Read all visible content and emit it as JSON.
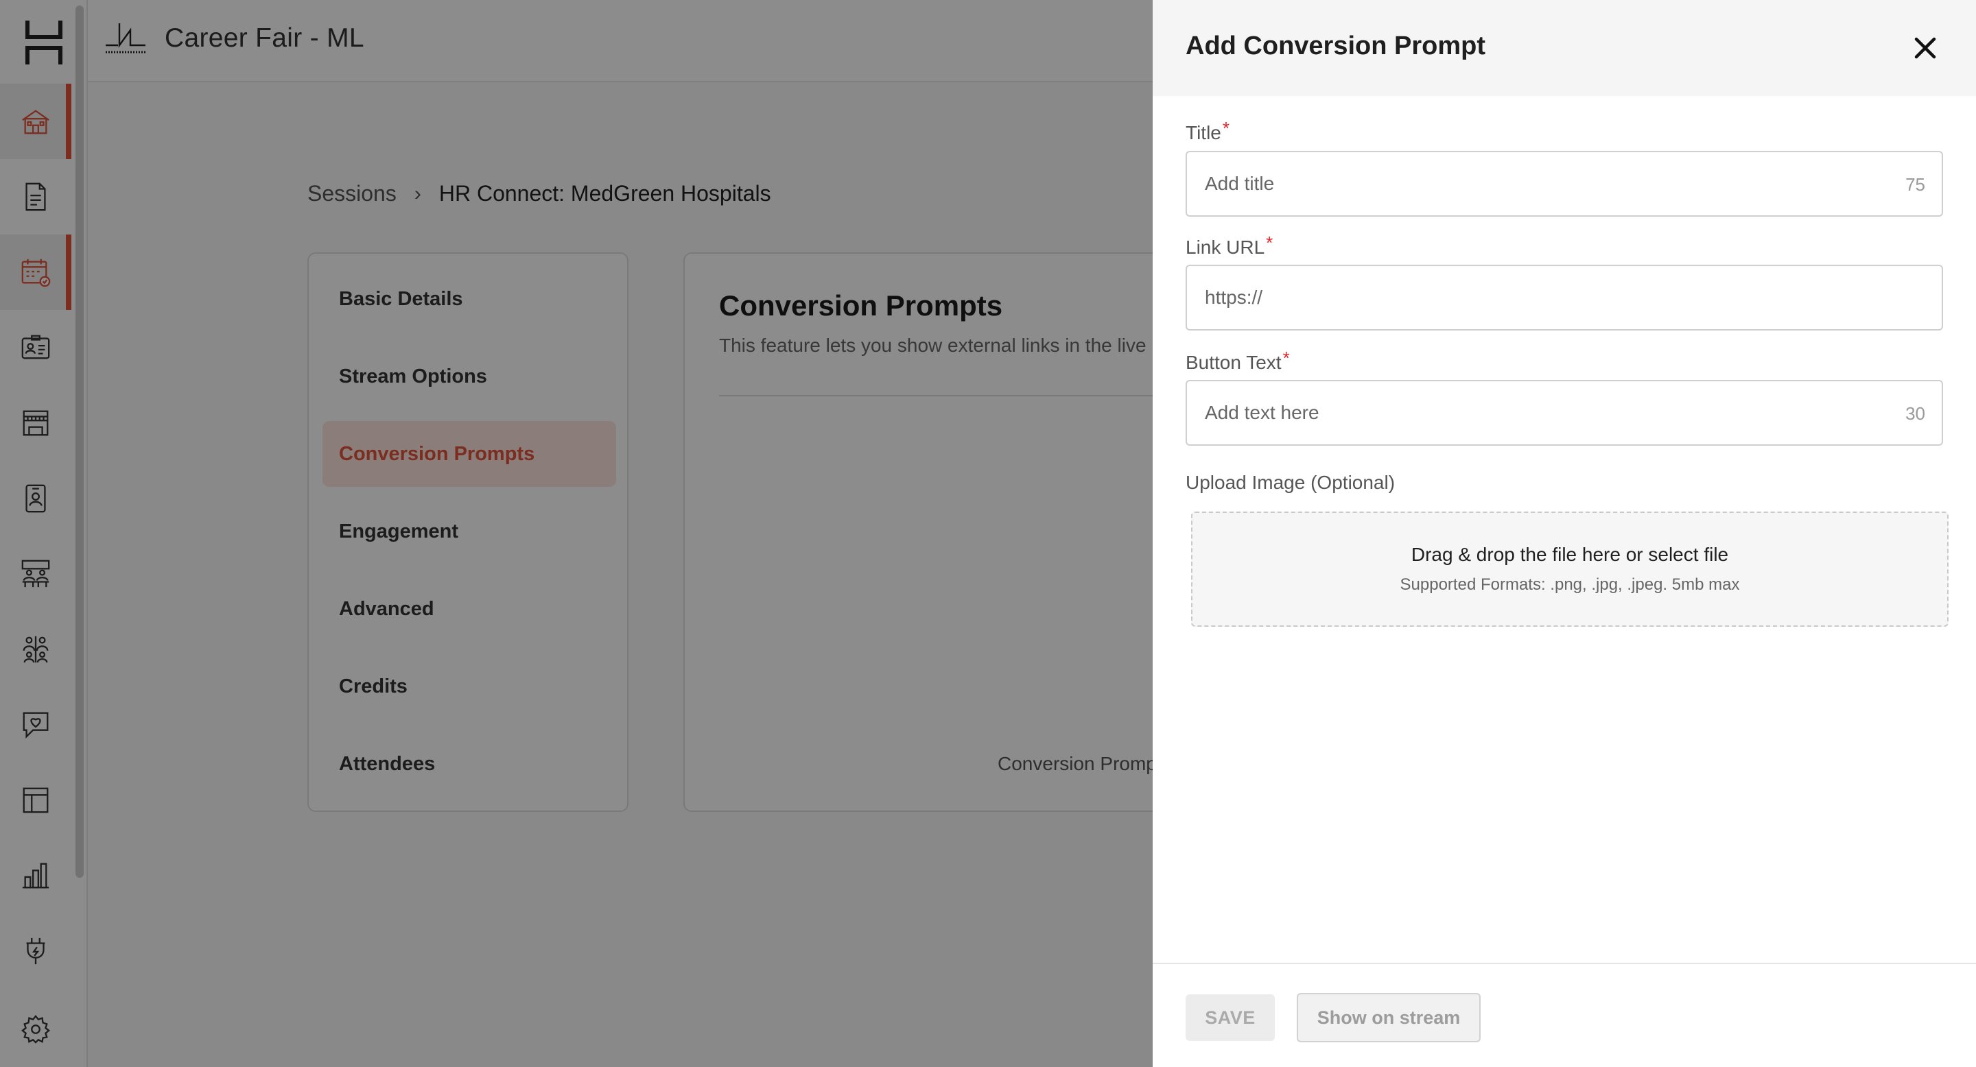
{
  "app": {
    "event_title": "Career Fair - ML",
    "rail_icons": [
      "app-logo-icon",
      "home-icon",
      "document-icon",
      "calendar-icon",
      "id-card-icon",
      "booth-icon",
      "badge-icon",
      "lounge-icon",
      "networking-icon",
      "chat-heart-icon",
      "layout-icon",
      "analytics-icon",
      "integrations-icon",
      "settings-icon"
    ],
    "active_rail_items": [
      "home-icon",
      "calendar-icon"
    ]
  },
  "breadcrumb": {
    "root": "Sessions",
    "separator": "›",
    "current": "HR Connect: MedGreen Hospitals"
  },
  "side_menu": {
    "items": [
      {
        "label": "Basic Details"
      },
      {
        "label": "Stream Options"
      },
      {
        "label": "Conversion Prompts",
        "active": true
      },
      {
        "label": "Engagement"
      },
      {
        "label": "Advanced"
      },
      {
        "label": "Credits"
      },
      {
        "label": "Attendees"
      }
    ]
  },
  "content": {
    "title": "Conversion Prompts",
    "description": "This feature lets you show external links in the live",
    "empty_label": "Conversion Promp"
  },
  "drawer": {
    "title": "Add Conversion Prompt",
    "title_field": {
      "label": "Title",
      "required_mark": "*",
      "placeholder": "Add title",
      "value": "",
      "counter": "75"
    },
    "url_field": {
      "label": "Link URL",
      "required_mark": "*",
      "placeholder": "https://",
      "value": ""
    },
    "button_text_field": {
      "label": "Button Text",
      "required_mark": "*",
      "placeholder": "Add text here",
      "value": "",
      "counter": "30"
    },
    "upload": {
      "label": "Upload Image (Optional)",
      "drop_text": "Drag & drop the file here or select file",
      "formats_text": "Supported Formats: .png, .jpg, .jpeg. 5mb max"
    },
    "save_label": "SAVE",
    "stream_label": "Show on stream"
  },
  "colors": {
    "accent": "#e0523b",
    "active_menu_bg": "#fbe4df",
    "required": "#e0252b",
    "overlay": "rgba(0,0,0,0.45)"
  }
}
